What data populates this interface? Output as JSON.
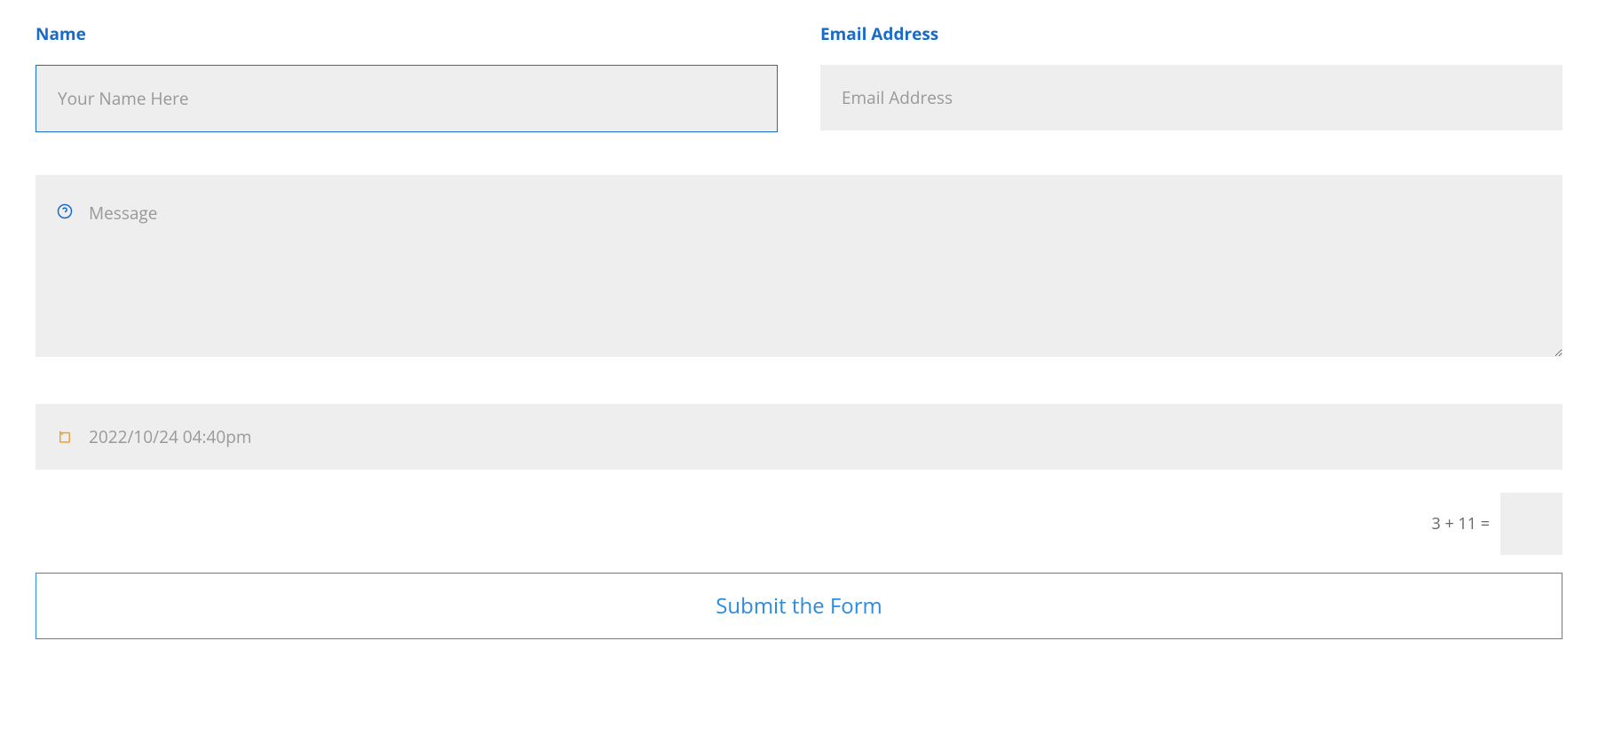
{
  "form": {
    "name": {
      "label": "Name",
      "placeholder": "Your Name Here",
      "value": ""
    },
    "email": {
      "label": "Email Address",
      "placeholder": "Email Address",
      "value": ""
    },
    "message": {
      "placeholder": "Message",
      "value": ""
    },
    "datetime": {
      "placeholder": "2022/10/24 04:40pm",
      "value": ""
    },
    "captcha": {
      "question": "3 + 11 =",
      "value": ""
    },
    "submit_label": "Submit the Form"
  }
}
